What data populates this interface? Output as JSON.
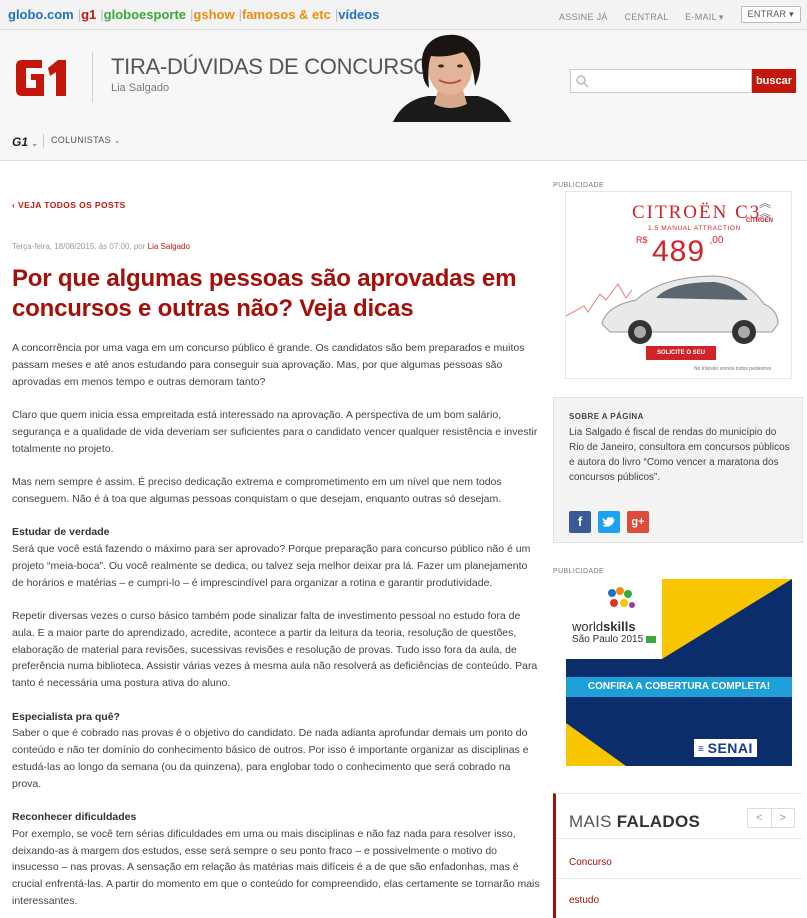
{
  "topbar": {
    "links": [
      "globo.com",
      "g1",
      "globoesporte",
      "gshow",
      "famosos & etc",
      "vídeos"
    ],
    "right_links": [
      "ASSINE JÁ",
      "CENTRAL",
      "E-MAIL",
      "ENTRAR"
    ]
  },
  "header": {
    "blog_title": "TIRA-DÚVIDAS DE CONCURSOS",
    "author": "Lia Salgado",
    "search_button": "buscar",
    "search_placeholder": ""
  },
  "nav": {
    "g1": "G1",
    "colunistas": "COLUNISTAS"
  },
  "article": {
    "back_link": "VEJA TODOS OS POSTS",
    "meta_date": "Terça-feira, 18/08/2015, às 07:00, por",
    "meta_author": "Lia Salgado",
    "headline": "Por que algumas pessoas são aprovadas em concursos e outras não? Veja dicas",
    "p1": "A concorrência por uma vaga em um concurso público é grande. Os candidatos são bem preparados e muitos passam meses e até anos estudando para conseguir sua aprovação. Mas, por que algumas pessoas são aprovadas em menos tempo e outras demoram tanto?",
    "p2": "Claro que quem inicia essa empreitada está interessado na aprovação. A perspectiva de um bom salário, segurança e a qualidade de vida deveriam ser suficientes para o candidato vencer qualquer resistência e investir totalmente no projeto.",
    "p3": "Mas nem sempre é assim. É preciso dedicação extrema e comprometimento em um nível que nem todos conseguem. Não é à toa que algumas pessoas conquistam o que desejam, enquanto outras só desejam.",
    "h1": "Estudar de verdade",
    "p4": "Será que você está fazendo o máximo para ser aprovado? Porque preparação para concurso público não é um projeto “meia-boca”. Ou você realmente se dedica, ou talvez seja melhor deixar pra lá. Fazer um planejamento de horários e matérias – e cumpri-lo – é imprescindível para organizar a rotina e garantir produtividade.",
    "p5": "Repetir diversas vezes o curso básico também pode sinalizar falta de investimento pessoal no estudo fora de aula. E a maior parte do aprendizado, acredite, acontece a partir da leitura da teoria, resolução de questões, elaboração de material para revisões, sucessivas revisões e resolução de provas. Tudo isso fora da aula, de preferência numa biblioteca. Assistir várias vezes à mesma aula não resolverá as deficiências de conteúdo. Para tanto é necessária uma postura ativa do aluno.",
    "h2": "Especialista pra quê?",
    "p6": "Saber o que é cobrado nas provas é o objetivo do candidato. De nada adianta aprofundar demais um ponto do conteúdo e não ter domínio do conhecimento básico de outros. Por isso é importante organizar as disciplinas e estudá-las ao longo da semana (ou da quinzena), para englobar todo o conhecimento que será cobrado na prova.",
    "h3": "Reconhecer dificuldades",
    "p7": "Por exemplo, se você tem sérias dificuldades em uma ou mais disciplinas e não faz nada para resolver isso, deixando-as à margem dos estudos, esse será sempre o seu ponto fraco – e possivelmente o motivo do insucesso – nas provas. A sensação em relação às matérias mais difíceis é a de que são enfadonhas, mas é crucial enfrentá-las. A partir do momento em que o conteúdo for compreendido, elas certamente se tornarão mais interessantes."
  },
  "sidebar": {
    "pub_label": "PUBLICIDADE",
    "ad1": {
      "brand": "CITROËN C3",
      "subline": "1.5 MANUAL ATTRACTION",
      "currency": "R$",
      "price": "489",
      "cents": ",00",
      "cta": "SOLICITE O SEU",
      "logo_text": "CITROËN",
      "footer_right": "No trânsito somos todos pedestres"
    },
    "about": {
      "title": "SOBRE A PÁGINA",
      "text": "Lia Salgado é fiscal de rendas do município do Rio de Janeiro, consultora em concursos públicos e autora do livro “Como vencer a maratona dos concursos públicos”."
    },
    "ad2": {
      "line1": "world",
      "line1b": "skills",
      "line2": "São Paulo 2015",
      "cta": "CONFIRA A COBERTURA COMPLETA!",
      "logo": "SENAI"
    },
    "mais": {
      "title_a": "MAIS",
      "title_b": "FALADOS",
      "items": [
        "Concurso",
        "estudo"
      ]
    },
    "colors": {
      "brand_red": "#c4170c",
      "headline_red": "#a3100a",
      "facebook": "#3b5998",
      "twitter": "#1da1f2",
      "gplus": "#dd4b39",
      "senai_blue": "#0c2d6b"
    }
  }
}
